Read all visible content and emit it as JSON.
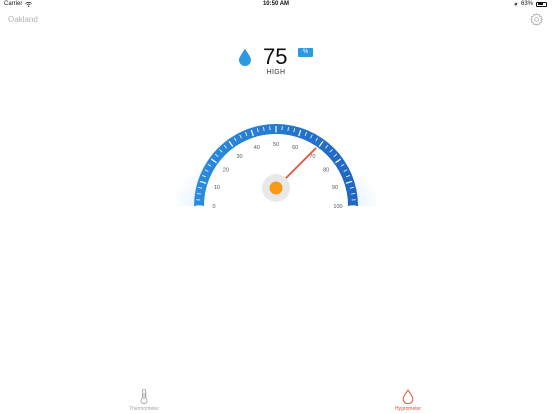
{
  "status_bar": {
    "carrier": "Carrier",
    "time": "10:50 AM",
    "battery": "63%",
    "battery_level": 0.63
  },
  "header": {
    "location": "Oakland",
    "settings_icon": "gear-icon"
  },
  "reading": {
    "value": "75",
    "unit": "%",
    "level": "HIGH",
    "icon": "water-drop-icon"
  },
  "gauge": {
    "min": 0,
    "max": 100,
    "value": 75,
    "tick_labels": [
      "0",
      "10",
      "20",
      "30",
      "40",
      "50",
      "60",
      "70",
      "80",
      "90",
      "100"
    ],
    "colors": {
      "arc_light": "#2a8ce0",
      "arc_dark": "#1f66c2",
      "needle": "#e2553a",
      "hub": "#f59a12",
      "hub_ring": "#e8e8e8"
    }
  },
  "tabs": [
    {
      "label": "Thermometer",
      "icon": "thermometer-icon",
      "active": false
    },
    {
      "label": "Hygrometer",
      "icon": "water-drop-icon",
      "active": true
    }
  ],
  "colors": {
    "accent_blue": "#2a9ae3",
    "active_tab": "#e2553a",
    "inactive_tab": "#a6a6a6"
  }
}
